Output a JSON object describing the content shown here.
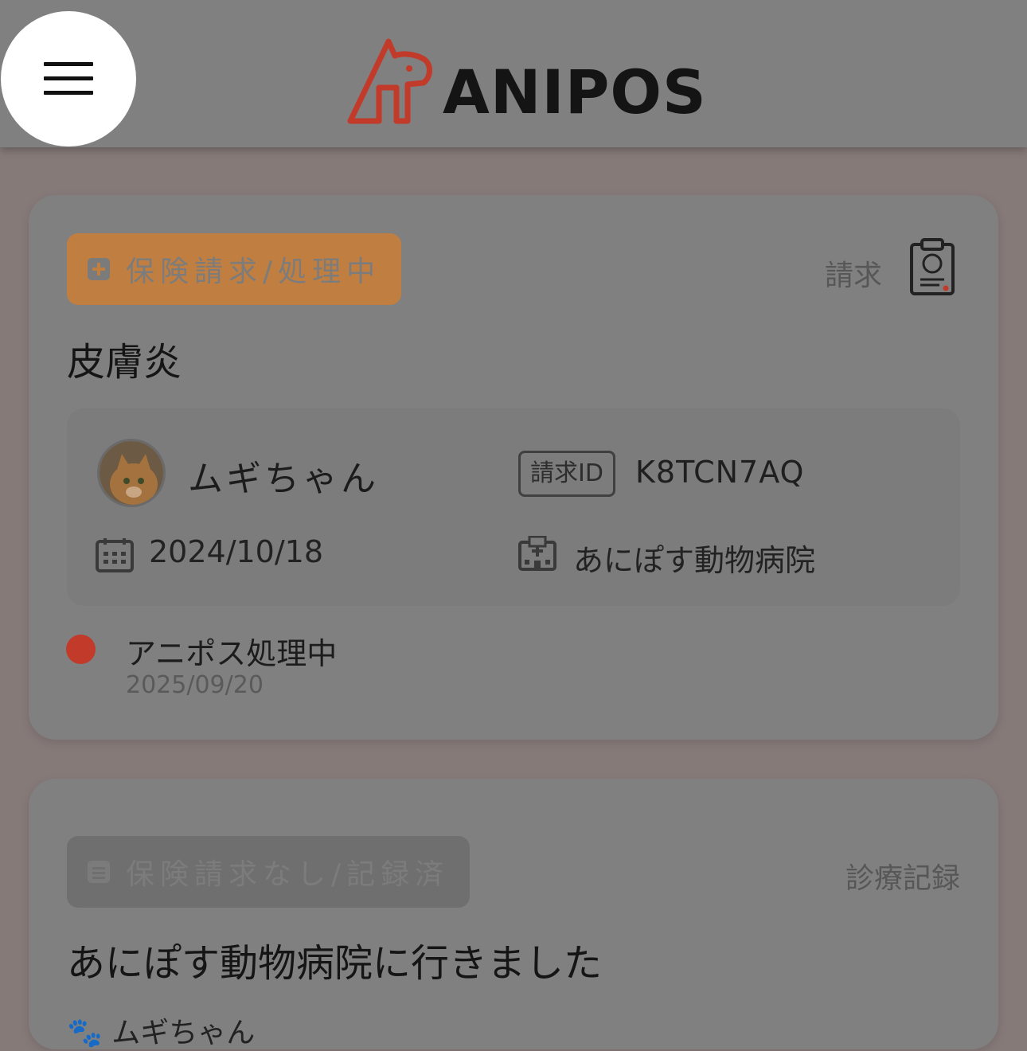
{
  "header": {
    "logo_text": "ANIPOS",
    "menu_icon": "hamburger-menu-icon",
    "brand_color": "#c13a2a"
  },
  "cards": [
    {
      "badge": {
        "label": "保険請求/処理中",
        "icon": "plus-square-icon",
        "color": "#c07f40"
      },
      "type_label": "請求",
      "type_icon": "clipboard-document-icon",
      "title": "皮膚炎",
      "pet_name": "ムギちゃん",
      "claim_id_label": "請求ID",
      "claim_id": "K8TCN7AQ",
      "date": "2024/10/18",
      "hospital": "あにぽす動物病院",
      "status": {
        "text": "アニポス処理中",
        "date": "2025/09/20",
        "color": "#c13a2a"
      }
    },
    {
      "badge": {
        "label": "保険請求なし/記録済",
        "icon": "document-icon"
      },
      "type_label": "診療記録",
      "title": "あにぽす動物病院に行きました",
      "pet_name": "ムギちゃん"
    }
  ]
}
